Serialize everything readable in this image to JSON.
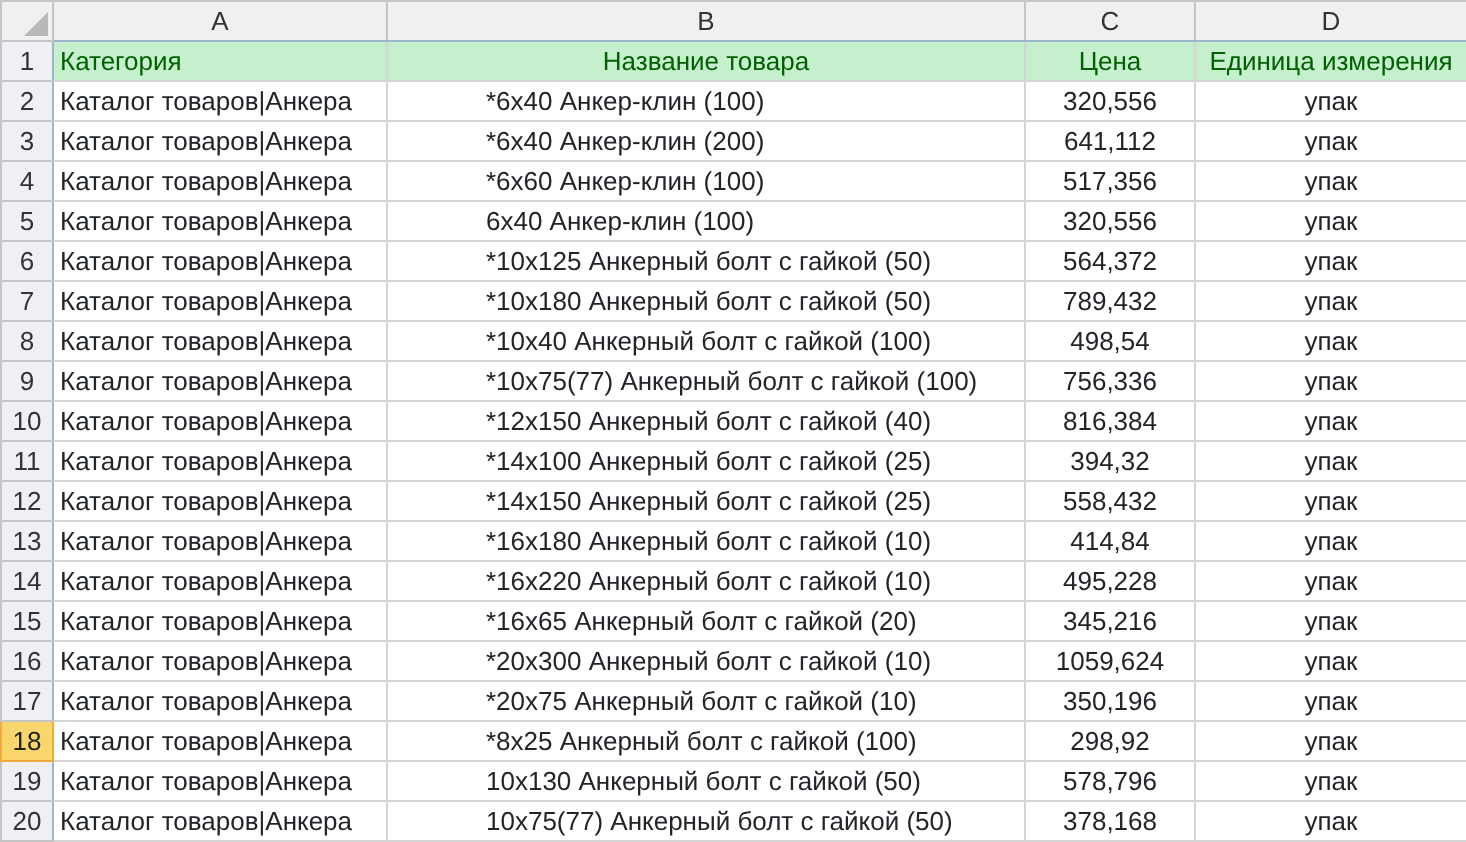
{
  "columns": [
    "A",
    "B",
    "C",
    "D"
  ],
  "rows": [
    {
      "number": "1",
      "selected": false,
      "kind": "header",
      "cells": [
        "Категория",
        "Название товара",
        "Цена",
        "Единица измерения"
      ]
    },
    {
      "number": "2",
      "selected": false,
      "kind": "data",
      "cells": [
        "Каталог товаров|Анкера",
        "*6x40 Анкер-клин (100)",
        "320,556",
        "упак"
      ]
    },
    {
      "number": "3",
      "selected": false,
      "kind": "data",
      "cells": [
        "Каталог товаров|Анкера",
        "*6x40 Анкер-клин (200)",
        "641,112",
        "упак"
      ]
    },
    {
      "number": "4",
      "selected": false,
      "kind": "data",
      "cells": [
        "Каталог товаров|Анкера",
        "*6x60 Анкер-клин (100)",
        "517,356",
        "упак"
      ]
    },
    {
      "number": "5",
      "selected": false,
      "kind": "data",
      "cells": [
        "Каталог товаров|Анкера",
        "6x40 Анкер-клин (100)",
        "320,556",
        "упак"
      ]
    },
    {
      "number": "6",
      "selected": false,
      "kind": "data",
      "cells": [
        "Каталог товаров|Анкера",
        "*10x125 Анкерный болт с гайкой (50)",
        "564,372",
        "упак"
      ]
    },
    {
      "number": "7",
      "selected": false,
      "kind": "data",
      "cells": [
        "Каталог товаров|Анкера",
        "*10x180 Анкерный болт с гайкой (50)",
        "789,432",
        "упак"
      ]
    },
    {
      "number": "8",
      "selected": false,
      "kind": "data",
      "cells": [
        "Каталог товаров|Анкера",
        "*10x40 Анкерный болт с гайкой (100)",
        "498,54",
        "упак"
      ]
    },
    {
      "number": "9",
      "selected": false,
      "kind": "data",
      "cells": [
        "Каталог товаров|Анкера",
        "*10x75(77) Анкерный болт с гайкой (100)",
        "756,336",
        "упак"
      ]
    },
    {
      "number": "10",
      "selected": false,
      "kind": "data",
      "cells": [
        "Каталог товаров|Анкера",
        "*12x150 Анкерный болт с гайкой (40)",
        "816,384",
        "упак"
      ]
    },
    {
      "number": "11",
      "selected": false,
      "kind": "data",
      "cells": [
        "Каталог товаров|Анкера",
        "*14x100 Анкерный болт с гайкой (25)",
        "394,32",
        "упак"
      ]
    },
    {
      "number": "12",
      "selected": false,
      "kind": "data",
      "cells": [
        "Каталог товаров|Анкера",
        "*14x150 Анкерный болт с гайкой (25)",
        "558,432",
        "упак"
      ]
    },
    {
      "number": "13",
      "selected": false,
      "kind": "data",
      "cells": [
        "Каталог товаров|Анкера",
        "*16x180 Анкерный болт с гайкой (10)",
        "414,84",
        "упак"
      ]
    },
    {
      "number": "14",
      "selected": false,
      "kind": "data",
      "cells": [
        "Каталог товаров|Анкера",
        "*16x220 Анкерный болт с гайкой (10)",
        "495,228",
        "упак"
      ]
    },
    {
      "number": "15",
      "selected": false,
      "kind": "data",
      "cells": [
        "Каталог товаров|Анкера",
        "*16x65 Анкерный болт с гайкой (20)",
        "345,216",
        "упак"
      ]
    },
    {
      "number": "16",
      "selected": false,
      "kind": "data",
      "cells": [
        "Каталог товаров|Анкера",
        "*20x300 Анкерный болт с гайкой (10)",
        "1059,624",
        "упак"
      ]
    },
    {
      "number": "17",
      "selected": false,
      "kind": "data",
      "cells": [
        "Каталог товаров|Анкера",
        "*20x75 Анкерный болт с гайкой (10)",
        "350,196",
        "упак"
      ]
    },
    {
      "number": "18",
      "selected": true,
      "kind": "data",
      "cells": [
        "Каталог товаров|Анкера",
        "*8x25 Анкерный болт с гайкой (100)",
        "298,92",
        "упак"
      ]
    },
    {
      "number": "19",
      "selected": false,
      "kind": "data",
      "cells": [
        "Каталог товаров|Анкера",
        "10x130 Анкерный болт с гайкой (50)",
        "578,796",
        "упак"
      ]
    },
    {
      "number": "20",
      "selected": false,
      "kind": "data",
      "cells": [
        "Каталог товаров|Анкера",
        "10x75(77) Анкерный болт с гайкой (50)",
        "378,168",
        "упак"
      ]
    }
  ]
}
